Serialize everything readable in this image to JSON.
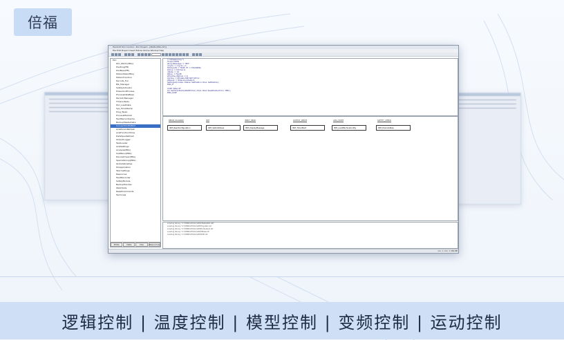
{
  "brand": {
    "label": "倍福"
  },
  "tagline": "逻辑控制 | 温度控制 | 模型控制 | 变频控制 | 运动控制",
  "window": {
    "title": "TwinCAT PLC Control - PLC Project - [MAIN (PRG-ST)]",
    "menu": "File  Edit  Project  Insert  Extras  Online  Window  Help",
    "tree_items": [
      "PLC",
      "PLC_POUS (PRG)",
      "PouProg(FB)",
      "PouBase(FB)",
      "MotionMain(PRG)",
      "MotionFunction",
      "Decode_Fun",
      "Blk_Manager",
      "SafetyActivator",
      "PowerAndProcess",
      "ProcessDataBase",
      "PeriodicManager",
      "Timers-Tasks",
      "PLC_LoadData",
      "Sys_TimeStamp",
      "Prog_Tasks",
      "ProcessMainLib",
      "FaultRecordCache",
      "BackupMasterData",
      "ConvertXmlToHtml",
      "AxisParamRefresh",
      "AxisFunctionShow",
      "DataSpecRefresh",
      "OutputLogger",
      "TaskLoader",
      "AxisSettings",
      "Analysis(PRG)",
      "SubMenu(PRG)",
      "DeviceDriver(PRG)",
      "SpecialGroup(PRG)",
      "GlobalVariables",
      "PlcApplication",
      "Task Settings",
      "Resources",
      "FaultRecorder",
      "SafetyModule",
      "BackupHandler",
      "Watchlists",
      "ResetCommands",
      "Terminals"
    ],
    "tree_tabs": [
      "POUs",
      "Data types",
      "Visu",
      "Resources"
    ],
    "code_lines": [
      "(* Initialisierung *)",
      "IF bInit THEN",
      "  stLog.sMessage := 'INIT';",
      "  nCycle := nCycle + 1;",
      "  fbTimer(IN := TRUE, PT := T#100MS);",
      "  bDone := fbTimer.Q;",
      "  nState := 10;",
      "  bBusy := FALSE;",
      "  stHandle.nRetries := 0;",
      "  bActive := bEnable AND NOT bError;",
      "  stResult := fbDevice.stOutput;",
      "  SetOutput(nIndex, bValue, SetPosition, Pos1, SetPosition);",
      "END_IF",
      "",
      "CASE nStep OF",
      "  10: SetTimerStart(ADR(fbTimer), Pos1, Pos2, ReadPositionFrom, 'PBS');",
      "END_CASE"
    ],
    "diagram_headers": [
      "BEGIN_DIAGRAM",
      "INIT",
      "INPUT_READ",
      "OUTPUT_WRITE",
      "AXIS_STATE",
      "SAFETY_CHECK"
    ],
    "diagram_blocks": [
      "INIT_ReadConfiguration",
      "INIT_SetInitValues",
      "INIT_DisplayMessage",
      "INIT_TimerStart",
      "INIT_LoadMachineConfig",
      "INIT_ExecuteStep"
    ],
    "output_lines": [
      "Loading library 'C:\\TWINCAT\\PLC\\LIB\\STANDARD.LIB'",
      "Loading library 'C:\\TWINCAT\\PLC\\LIB\\TcSystem.lib'",
      "Loading library 'C:\\TWINCAT\\PLC\\LIB\\PLCSystem.lib'",
      "Loading library 'C:\\TWINCAT\\PLC\\LIB\\TcBase.lib'",
      "Loading library 'C:\\TWINCAT\\PLC\\LIB\\TcMC.lib'"
    ],
    "status": "Lin.: 1, Col.: 1   ONLINE"
  }
}
